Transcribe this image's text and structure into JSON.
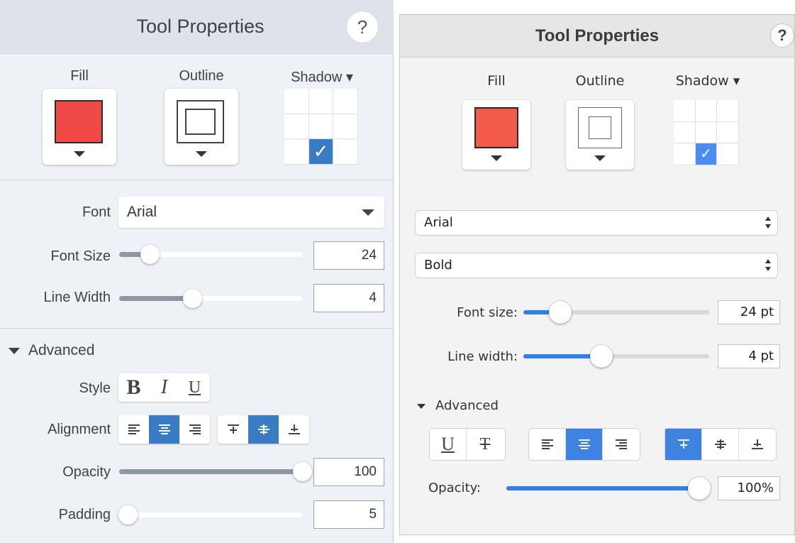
{
  "left_panel": {
    "title": "Tool Properties",
    "help_glyph": "?",
    "fill": {
      "label": "Fill",
      "color": "#f04844"
    },
    "outline": {
      "label": "Outline"
    },
    "shadow": {
      "label": "Shadow ▾",
      "selected_cell": "bottom-center"
    },
    "font": {
      "label": "Font",
      "value": "Arial"
    },
    "font_size": {
      "label": "Font Size",
      "value": "24",
      "level": 0.17
    },
    "line_width": {
      "label": "Line Width",
      "value": "4",
      "level": 0.4
    },
    "advanced": {
      "label": "Advanced"
    },
    "style": {
      "label": "Style",
      "bold": "B",
      "italic": "I",
      "underline": "U"
    },
    "alignment": {
      "label": "Alignment",
      "horizontal_selected": "center",
      "vertical_selected": "middle"
    },
    "opacity": {
      "label": "Opacity",
      "value": "100",
      "level": 1.0
    },
    "padding": {
      "label": "Padding",
      "value": "5",
      "level": 0.05
    },
    "accent_color": "#3a7cc4"
  },
  "right_panel": {
    "title": "Tool Properties",
    "help_glyph": "?",
    "fill": {
      "label": "Fill",
      "color": "#f25a4a"
    },
    "outline": {
      "label": "Outline"
    },
    "shadow": {
      "label": "Shadow ▾",
      "selected_cell": "bottom-center"
    },
    "font_family": "Arial",
    "font_weight": "Bold",
    "font_size": {
      "label": "Font size:",
      "value": "24 pt",
      "level": 0.2
    },
    "line_width": {
      "label": "Line width:",
      "value": "4 pt",
      "level": 0.42
    },
    "advanced": {
      "label": "Advanced"
    },
    "text_style": {
      "underline": "U",
      "strikethrough": "T"
    },
    "alignment": {
      "horizontal_selected": "center",
      "vertical_selected": "top"
    },
    "opacity": {
      "label": "Opacity:",
      "value": "100%",
      "level": 1.0
    },
    "accent_color": "#2f7ff0"
  }
}
